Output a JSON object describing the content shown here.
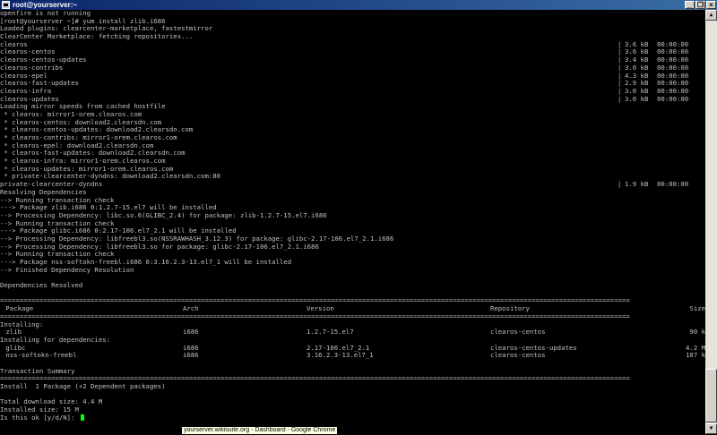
{
  "window": {
    "title": "root@yourserver:~"
  },
  "terminal": {
    "lines": [
      "openfire is not running",
      "[root@yourserver ~]# yum install zlib.i686",
      "Loaded plugins: clearcenter-marketplace, fastestmirror",
      "ClearCenter Marketplace: fetching repositories...",
      {
        "name": "clearos",
        "sep": "|",
        "size": "3.6 kB",
        "time": "00:00:00"
      },
      {
        "name": "clearos-centos",
        "sep": "|",
        "size": "3.6 kB",
        "time": "00:00:00"
      },
      {
        "name": "clearos-centos-updates",
        "sep": "|",
        "size": "3.4 kB",
        "time": "00:00:00"
      },
      {
        "name": "clearos-contribs",
        "sep": "|",
        "size": "3.0 kB",
        "time": "00:00:00"
      },
      {
        "name": "clearos-epel",
        "sep": "|",
        "size": "4.3 kB",
        "time": "00:00:00"
      },
      {
        "name": "clearos-fast-updates",
        "sep": "|",
        "size": "2.9 kB",
        "time": "00:00:00"
      },
      {
        "name": "clearos-infra",
        "sep": "|",
        "size": "3.0 kB",
        "time": "00:00:00"
      },
      {
        "name": "clearos-updates",
        "sep": "|",
        "size": "3.0 kB",
        "time": "00:00:00"
      },
      "Loading mirror speeds from cached hostfile",
      " * clearos: mirror1-orem.clearos.com",
      " * clearos-centos: download2.clearsdn.com",
      " * clearos-centos-updates: download2.clearsdn.com",
      " * clearos-contribs: mirror1-orem.clearos.com",
      " * clearos-epel: download2.clearsdn.com",
      " * clearos-fast-updates: download2.clearsdn.com",
      " * clearos-infra: mirror1-orem.clearos.com",
      " * clearos-updates: mirror1-orem.clearos.com",
      " * private-clearcenter-dyndns: download2.clearsdn.com:80",
      {
        "name": "private-clearcenter-dyndns",
        "sep": "|",
        "size": "1.9 kB",
        "time": "00:00:00"
      },
      "Resolving Dependencies",
      "--> Running transaction check",
      "---> Package zlib.i686 0:1.2.7-15.el7 will be installed",
      "--> Processing Dependency: libc.so.6(GLIBC_2.4) for package: zlib-1.2.7-15.el7.i686",
      "--> Running transaction check",
      "---> Package glibc.i686 0:2.17-106.el7_2.1 will be installed",
      "--> Processing Dependency: libfreebl3.so(NSSRAWHASH_3.12.3) for package: glibc-2.17-106.el7_2.1.i686",
      "--> Processing Dependency: libfreebl3.so for package: glibc-2.17-106.el7_2.1.i686",
      "--> Running transaction check",
      "---> Package nss-softokn-freebl.i686 0:3.16.2.3-13.el7_1 will be installed",
      "--> Finished Dependency Resolution",
      "",
      "Dependencies Resolved",
      "",
      "================================================================================================================================================================",
      {
        "cols": [
          " Package",
          "Arch",
          "Version",
          "Repository",
          "Size"
        ]
      },
      "================================================================================================================================================================",
      "Installing:",
      {
        "cols": [
          " zlib",
          "i686",
          "1.2.7-15.el7",
          "clearos-centos",
          "90 k"
        ]
      },
      "Installing for dependencies:",
      {
        "cols": [
          " glibc",
          "i686",
          "2.17-106.el7_2.1",
          "clearos-centos-updates",
          "4.2 M"
        ]
      },
      {
        "cols": [
          " nss-softokn-freebl",
          "i686",
          "3.16.2.3-13.el7_1",
          "clearos-centos",
          "187 k"
        ]
      },
      "",
      "Transaction Summary",
      "================================================================================================================================================================",
      "Install  1 Package (+2 Dependent packages)",
      "",
      "Total download size: 4.4 M",
      "Installed size: 15 M",
      {
        "prompt": "Is this ok [y/d/N]: "
      }
    ]
  },
  "tooltip": "yourserver.wikisuite.org - Dashboard - Google Chrome",
  "colors": {
    "text": "#c0c0c0",
    "background": "#000000",
    "cursor": "#00ff00",
    "titlebar": "#0a246a"
  }
}
